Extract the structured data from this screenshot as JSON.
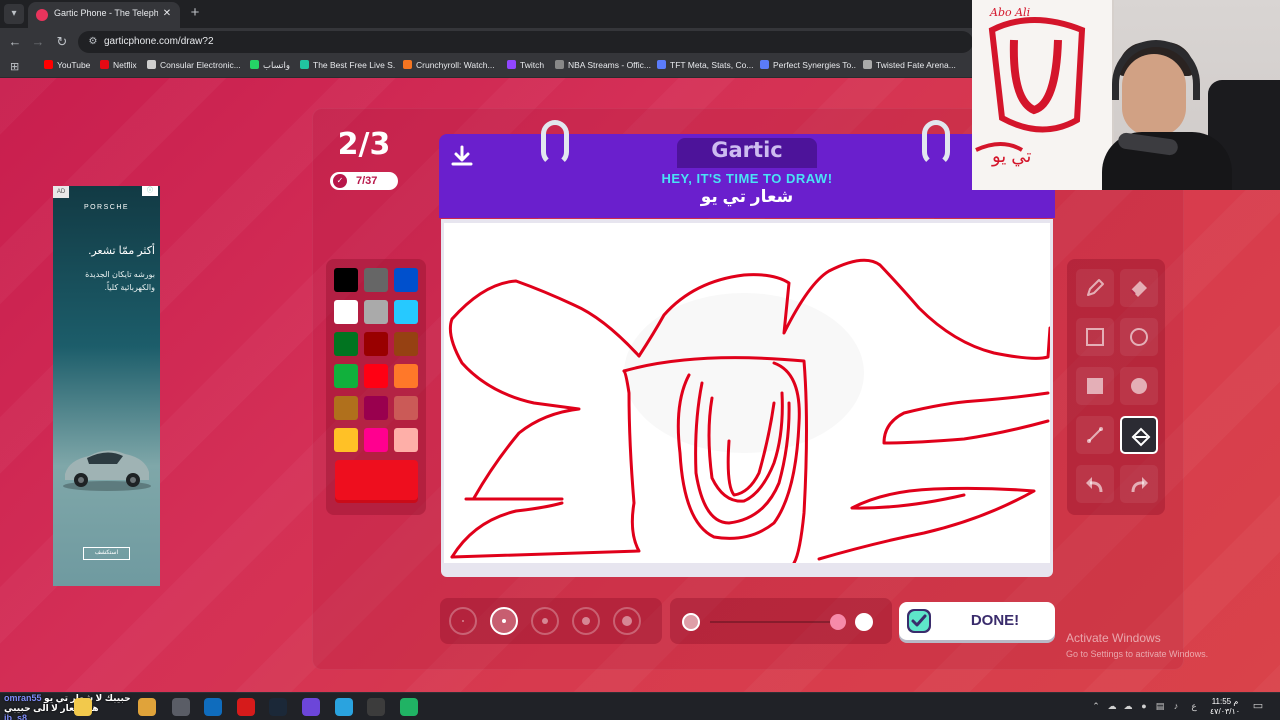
{
  "browser": {
    "tab_title": "Gartic Phone - The Telephone G",
    "tab_close": "✕",
    "new_tab": "+",
    "url": "garticphone.com/draw?2",
    "bookmarks": [
      {
        "label": "YouTube",
        "color": "#ff0000"
      },
      {
        "label": "Netflix",
        "color": "#e50914"
      },
      {
        "label": "Consular Electronic...",
        "color": "#cfcfcf"
      },
      {
        "label": "واتساب",
        "color": "#25d366"
      },
      {
        "label": "The Best Free Live S...",
        "color": "#21c4a0"
      },
      {
        "label": "Crunchyroll: Watch...",
        "color": "#f47521"
      },
      {
        "label": "Twitch",
        "color": "#9146ff"
      },
      {
        "label": "NBA Streams - Offic...",
        "color": "#888888"
      },
      {
        "label": "TFT Meta, Stats, Co...",
        "color": "#5b7cfa"
      },
      {
        "label": "Perfect Synergies To...",
        "color": "#5b7cfa"
      },
      {
        "label": "Twisted Fate Arena...",
        "color": "#aaaaaa"
      }
    ]
  },
  "ad": {
    "badge": "AD",
    "brand": "PORSCHE",
    "headline": "أكثر ممّا تشعر.",
    "body": "بورشه تايكان الجديدة والكهربائية كلياً.",
    "cta": "استكشف"
  },
  "game": {
    "round": "2/3",
    "players": "7/37",
    "logo": "Gartic",
    "header_title": "HEY, IT'S TIME TO DRAW!",
    "prompt": "شعار تي يو",
    "done_label": "DONE!",
    "palette": [
      "#000000",
      "#666666",
      "#0050cd",
      "#ffffff",
      "#aaaaaa",
      "#26c9ff",
      "#017420",
      "#990000",
      "#964112",
      "#11b03c",
      "#ff0013",
      "#ff7829",
      "#b0701c",
      "#99004e",
      "#cb5a57",
      "#ffc126",
      "#ff008f",
      "#feafa8"
    ],
    "current_color": "#ee0e1e",
    "tools": [
      "pencil",
      "eraser",
      "rectangle-outline",
      "ellipse-outline",
      "rectangle-filled",
      "ellipse-filled",
      "line",
      "fill-bucket",
      "undo",
      "redo"
    ],
    "active_tool": "fill-bucket",
    "brush_sizes": 5,
    "active_brush_size": 2,
    "stroke_color": "#e0001a"
  },
  "watermark": {
    "line1": "Activate Windows",
    "line2": "Go to Settings to activate Windows."
  },
  "webcam": {
    "poster_text": "Abo Ali",
    "poster_sign": "تي يو"
  },
  "taskbar": {
    "chat_name": "omran55",
    "chat_line1": "حبيبك لا شعار تي يو",
    "chat_line2": "هنا شعار لا الى حبيبي",
    "chat_name2": "ib_s8",
    "time": "11:55 م",
    "date": "٤٧/٠٣/١٠"
  }
}
